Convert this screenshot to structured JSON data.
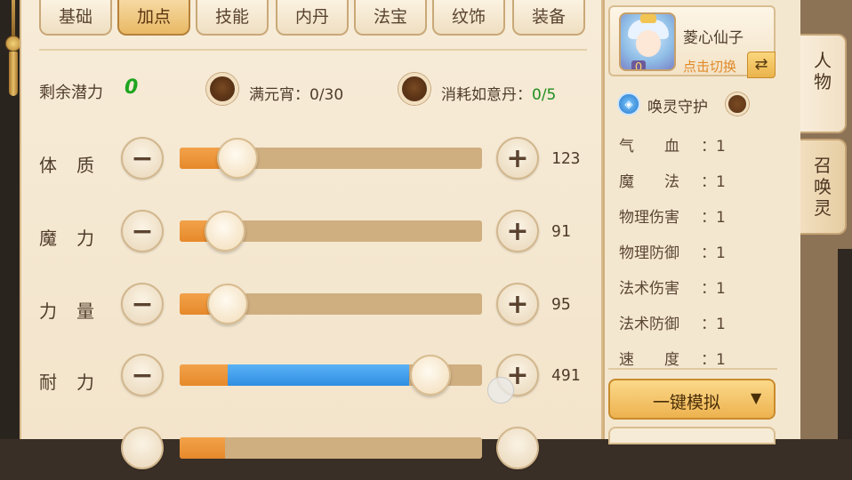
{
  "tabs": [
    "基础",
    "加点",
    "技能",
    "内丹",
    "法宝",
    "纹饰",
    "装备"
  ],
  "active_tab": "加点",
  "potential": {
    "label": "剩余潜力",
    "value": "0"
  },
  "items": [
    {
      "label": "满元宵：0/30",
      "value_suffix": ""
    },
    {
      "label": "消耗如意丹：",
      "value": "0/5"
    }
  ],
  "stats": [
    {
      "name": "体质",
      "value": "123",
      "fill_pct": 19,
      "knob_pct": 19
    },
    {
      "name": "魔力",
      "value": "91",
      "fill_pct": 15,
      "knob_pct": 15
    },
    {
      "name": "力量",
      "value": "95",
      "fill_pct": 16,
      "knob_pct": 16
    },
    {
      "name": "耐力",
      "value": "491",
      "fill_pct": 16,
      "blue_pct": 76,
      "knob_pct": 83
    }
  ],
  "character": {
    "name": "菱心仙子",
    "switch_label": "点击切换",
    "badge": "0"
  },
  "guard": {
    "label": "唤灵守护"
  },
  "attributes": [
    {
      "name": "气　　血",
      "value": "：1"
    },
    {
      "name": "魔　　法",
      "value": "：1"
    },
    {
      "name": "物理伤害",
      "value": "：1"
    },
    {
      "name": "物理防御",
      "value": "：1"
    },
    {
      "name": "法术伤害",
      "value": "：1"
    },
    {
      "name": "法术防御",
      "value": "：1"
    },
    {
      "name": "速　　度",
      "value": "：1"
    }
  ],
  "simulate_button": "一键模拟",
  "side_tabs": [
    "人物",
    "召唤灵"
  ],
  "colors": {
    "accent_orange": "#e6892b",
    "accent_blue": "#2f8ee3",
    "potential_green": "#1fa51f"
  }
}
